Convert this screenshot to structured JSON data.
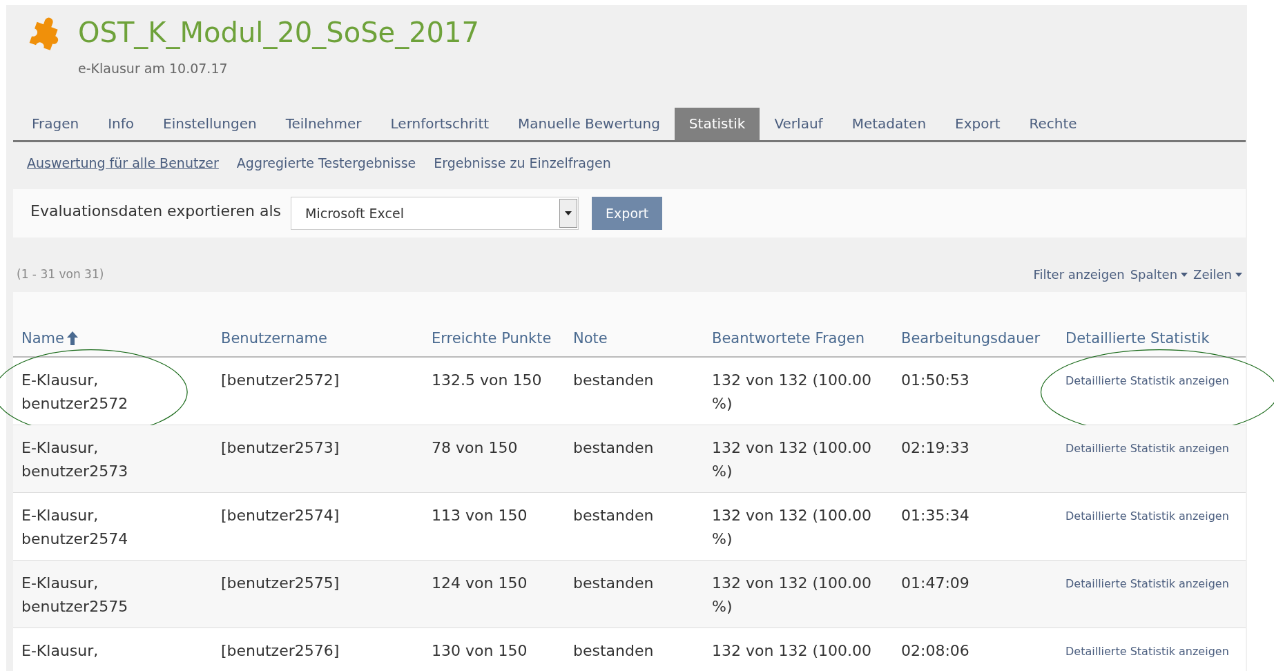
{
  "header": {
    "title": "OST_K_Modul_20_SoSe_2017",
    "subtitle": "e-Klausur am 10.07.17"
  },
  "tabs": [
    {
      "label": "Fragen",
      "selected": false
    },
    {
      "label": "Info",
      "selected": false
    },
    {
      "label": "Einstellungen",
      "selected": false
    },
    {
      "label": "Teilnehmer",
      "selected": false
    },
    {
      "label": "Lernfortschritt",
      "selected": false
    },
    {
      "label": "Manuelle Bewertung",
      "selected": false
    },
    {
      "label": "Statistik",
      "selected": true
    },
    {
      "label": "Verlauf",
      "selected": false
    },
    {
      "label": "Metadaten",
      "selected": false
    },
    {
      "label": "Export",
      "selected": false
    },
    {
      "label": "Rechte",
      "selected": false
    }
  ],
  "subtabs": [
    {
      "label": "Auswertung für alle Benutzer",
      "selected": true
    },
    {
      "label": "Aggregierte Testergebnisse",
      "selected": false
    },
    {
      "label": "Ergebnisse zu Einzelfragen",
      "selected": false
    }
  ],
  "export_bar": {
    "label": "Evaluationsdaten exportieren als",
    "format": "Microsoft Excel",
    "button": "Export"
  },
  "table": {
    "count": "(1 - 31 von 31)",
    "controls": [
      {
        "label": "Filter anzeigen",
        "kind": "link"
      },
      {
        "label": "Spalten",
        "kind": "dropdown"
      },
      {
        "label": "Zeilen",
        "kind": "dropdown"
      }
    ],
    "columns": [
      {
        "label": "Name",
        "sorted": true
      },
      {
        "label": "Benutzername",
        "sorted": false
      },
      {
        "label": "Erreichte Punkte",
        "sorted": false
      },
      {
        "label": "Note",
        "sorted": false
      },
      {
        "label": "Beantwortete Fragen",
        "sorted": false
      },
      {
        "label": "Bearbeitungsdauer",
        "sorted": false
      },
      {
        "label": "Detaillierte Statistik",
        "sorted": false
      }
    ],
    "rows": [
      {
        "name": "E-Klausur, benutzer2572",
        "username": "[benutzer2572]",
        "points": "132.5 von 150",
        "grade": "bestanden",
        "answered": "132 von 132 (100.00 %)",
        "duration": "01:50:53",
        "link": "Detaillierte Statistik anzeigen",
        "circled": true
      },
      {
        "name": "E-Klausur, benutzer2573",
        "username": "[benutzer2573]",
        "points": "78 von 150",
        "grade": "bestanden",
        "answered": "132 von 132 (100.00 %)",
        "duration": "02:19:33",
        "link": "Detaillierte Statistik anzeigen",
        "circled": false
      },
      {
        "name": "E-Klausur, benutzer2574",
        "username": "[benutzer2574]",
        "points": "113 von 150",
        "grade": "bestanden",
        "answered": "132 von 132 (100.00 %)",
        "duration": "01:35:34",
        "link": "Detaillierte Statistik anzeigen",
        "circled": false
      },
      {
        "name": "E-Klausur, benutzer2575",
        "username": "[benutzer2575]",
        "points": "124 von 150",
        "grade": "bestanden",
        "answered": "132 von 132 (100.00 %)",
        "duration": "01:47:09",
        "link": "Detaillierte Statistik anzeigen",
        "circled": false
      },
      {
        "name": "E-Klausur,",
        "username": "[benutzer2576]",
        "points": "130 von 150",
        "grade": "bestanden",
        "answered": "132 von 132 (100.00",
        "duration": "02:08:06",
        "link": "Detaillierte Statistik anzeigen",
        "circled": false
      }
    ]
  }
}
